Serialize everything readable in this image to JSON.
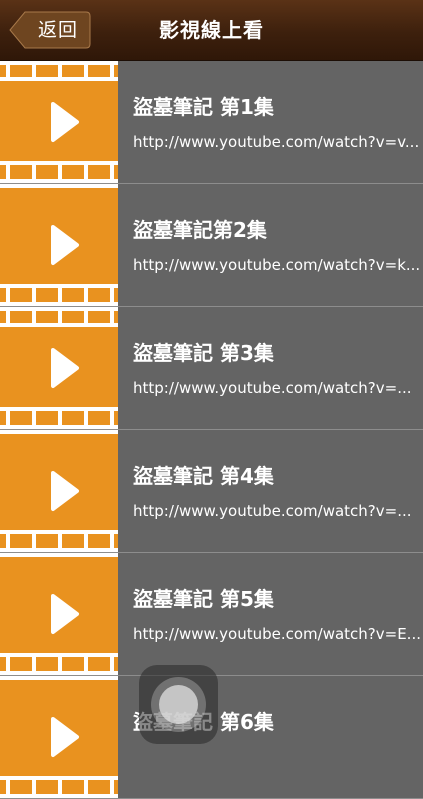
{
  "nav": {
    "back_label": "返回",
    "title": "影視線上看"
  },
  "videos": [
    {
      "title": "盜墓筆記 第1集",
      "url": "http://www.youtube.com/watch?v=v..."
    },
    {
      "title": "盜墓筆記第2集",
      "url": "http://www.youtube.com/watch?v=k..."
    },
    {
      "title": "盜墓筆記 第3集",
      "url": "http://www.youtube.com/watch?v=..."
    },
    {
      "title": "盜墓筆記 第4集",
      "url": "http://www.youtube.com/watch?v=..."
    },
    {
      "title": "盜墓筆記 第5集",
      "url": "http://www.youtube.com/watch?v=E..."
    },
    {
      "title": "盜墓筆記 第6集",
      "url": ""
    }
  ],
  "colors": {
    "nav_bar": "#3d200d",
    "thumb": "#e9921f",
    "list_bg": "#646464",
    "separator": "#8d8d8d"
  },
  "icons": {
    "back": "chevron-left-icon",
    "play": "play-icon",
    "assistive": "assistive-touch-icon"
  }
}
